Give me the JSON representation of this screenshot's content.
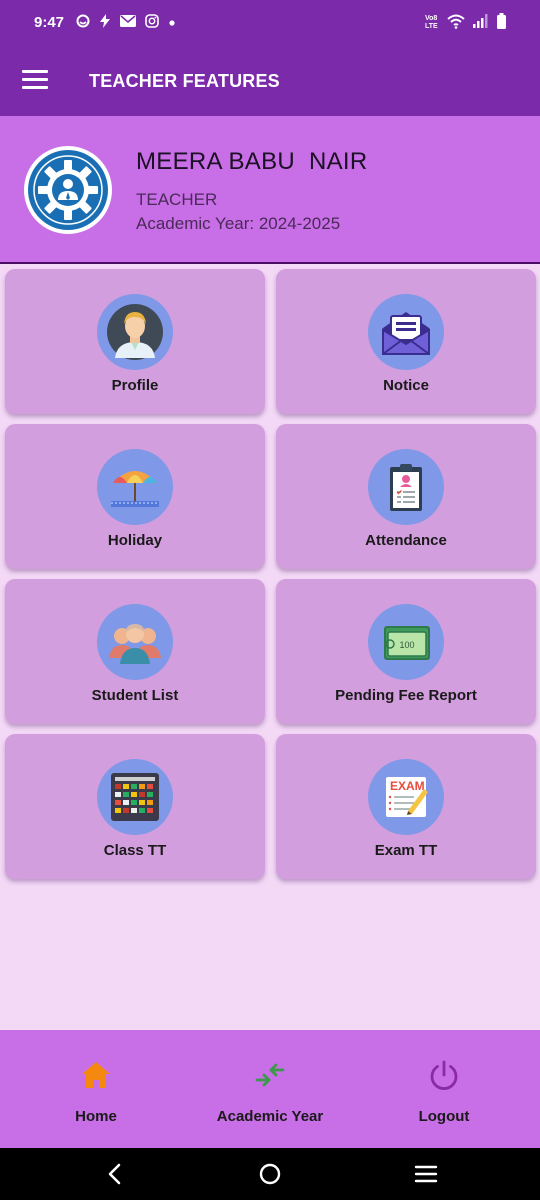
{
  "status_bar": {
    "time": "9:47",
    "left_icons": [
      "circle-status-icon",
      "bolt-icon",
      "mail-icon",
      "instagram-icon",
      "dot-icon"
    ],
    "right_icons": [
      "volte-icon",
      "wifi-icon",
      "signal-icon",
      "battery-icon"
    ],
    "volte_text": "Vo8 LTE"
  },
  "app_bar": {
    "title": "TEACHER FEATURES"
  },
  "profile": {
    "name": "MEERA BABU  NAIR",
    "role": "TEACHER",
    "academic_year": "Academic Year: 2024-2025"
  },
  "features": [
    {
      "label": "Profile",
      "icon": "teacher-avatar-icon"
    },
    {
      "label": "Notice",
      "icon": "envelope-notice-icon"
    },
    {
      "label": "Holiday",
      "icon": "beach-umbrella-icon"
    },
    {
      "label": "Attendance",
      "icon": "clipboard-icon"
    },
    {
      "label": "Student List",
      "icon": "students-group-icon"
    },
    {
      "label": "Pending Fee Report",
      "icon": "money-wallet-icon",
      "note_value": "100"
    },
    {
      "label": "Class TT",
      "icon": "timetable-grid-icon"
    },
    {
      "label": "Exam TT",
      "icon": "exam-paper-icon",
      "paper_text": "EXAM"
    }
  ],
  "bottom_nav": {
    "items": [
      {
        "label": "Home",
        "icon": "home-icon",
        "color": "#f5890f"
      },
      {
        "label": "Academic Year",
        "icon": "swap-arrows-icon",
        "color": "#3a9a4a"
      },
      {
        "label": "Logout",
        "icon": "power-icon",
        "color": "#8a2aa5"
      }
    ]
  },
  "colors": {
    "primary": "#7b2aa9",
    "header": "#c86ee6",
    "card": "#d39ede",
    "background": "#f3d9f6",
    "icon_circle": "#7f98e8"
  }
}
